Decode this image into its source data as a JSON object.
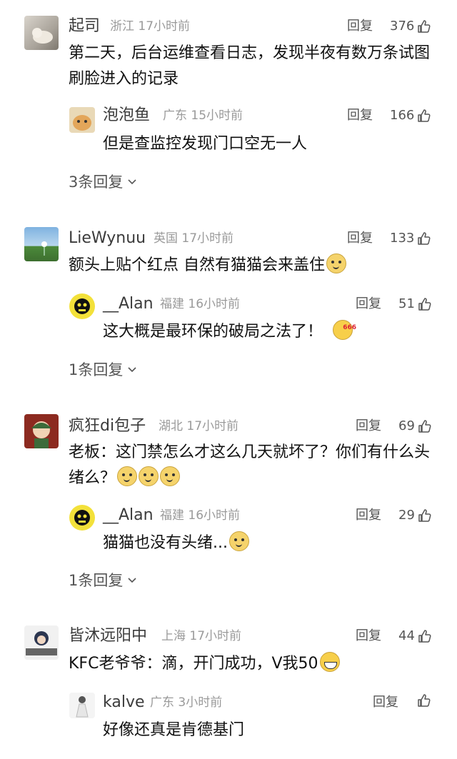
{
  "ui": {
    "reply_label": "回复"
  },
  "threads": [
    {
      "comment": {
        "name": "起司",
        "location": "浙江",
        "time": "17小时前",
        "likes": "376",
        "text": "第二天，后台运维查看日志，发现半夜有数万条试图刷脸进入的记录"
      },
      "reply": {
        "name": "泡泡鱼",
        "location": "广东",
        "time": "15小时前",
        "likes": "166",
        "text": "但是查监控发现门口空无一人"
      },
      "more": "3条回复"
    },
    {
      "comment": {
        "name": "LieWynuu",
        "location": "英国",
        "time": "17小时前",
        "likes": "133",
        "text": "额头上贴个红点 自然有猫猫会来盖住"
      },
      "reply": {
        "name": "__Alan",
        "location": "福建",
        "time": "16小时前",
        "likes": "51",
        "text": "这大概是最环保的破局之法了！"
      },
      "more": "1条回复"
    },
    {
      "comment": {
        "name": "疯狂di包子",
        "location": "湖北",
        "time": "17小时前",
        "likes": "69",
        "text": "老板：这门禁怎么才这么几天就坏了？你们有什么头绪么？"
      },
      "reply": {
        "name": "__Alan",
        "location": "福建",
        "time": "16小时前",
        "likes": "29",
        "text": "猫猫也没有头绪..."
      },
      "more": "1条回复"
    },
    {
      "comment": {
        "name": "皆沐远阳中",
        "location": "上海",
        "time": "17小时前",
        "likes": "44",
        "text": "KFC老爷爷：滴，开门成功，V我50"
      },
      "reply": {
        "name": "kalve",
        "location": "广东",
        "time": "3小时前",
        "likes": "",
        "text": "好像还真是肯德基门"
      }
    }
  ],
  "icons": {
    "like": "thumbs-up-icon",
    "expand": "chevron-down-icon"
  }
}
